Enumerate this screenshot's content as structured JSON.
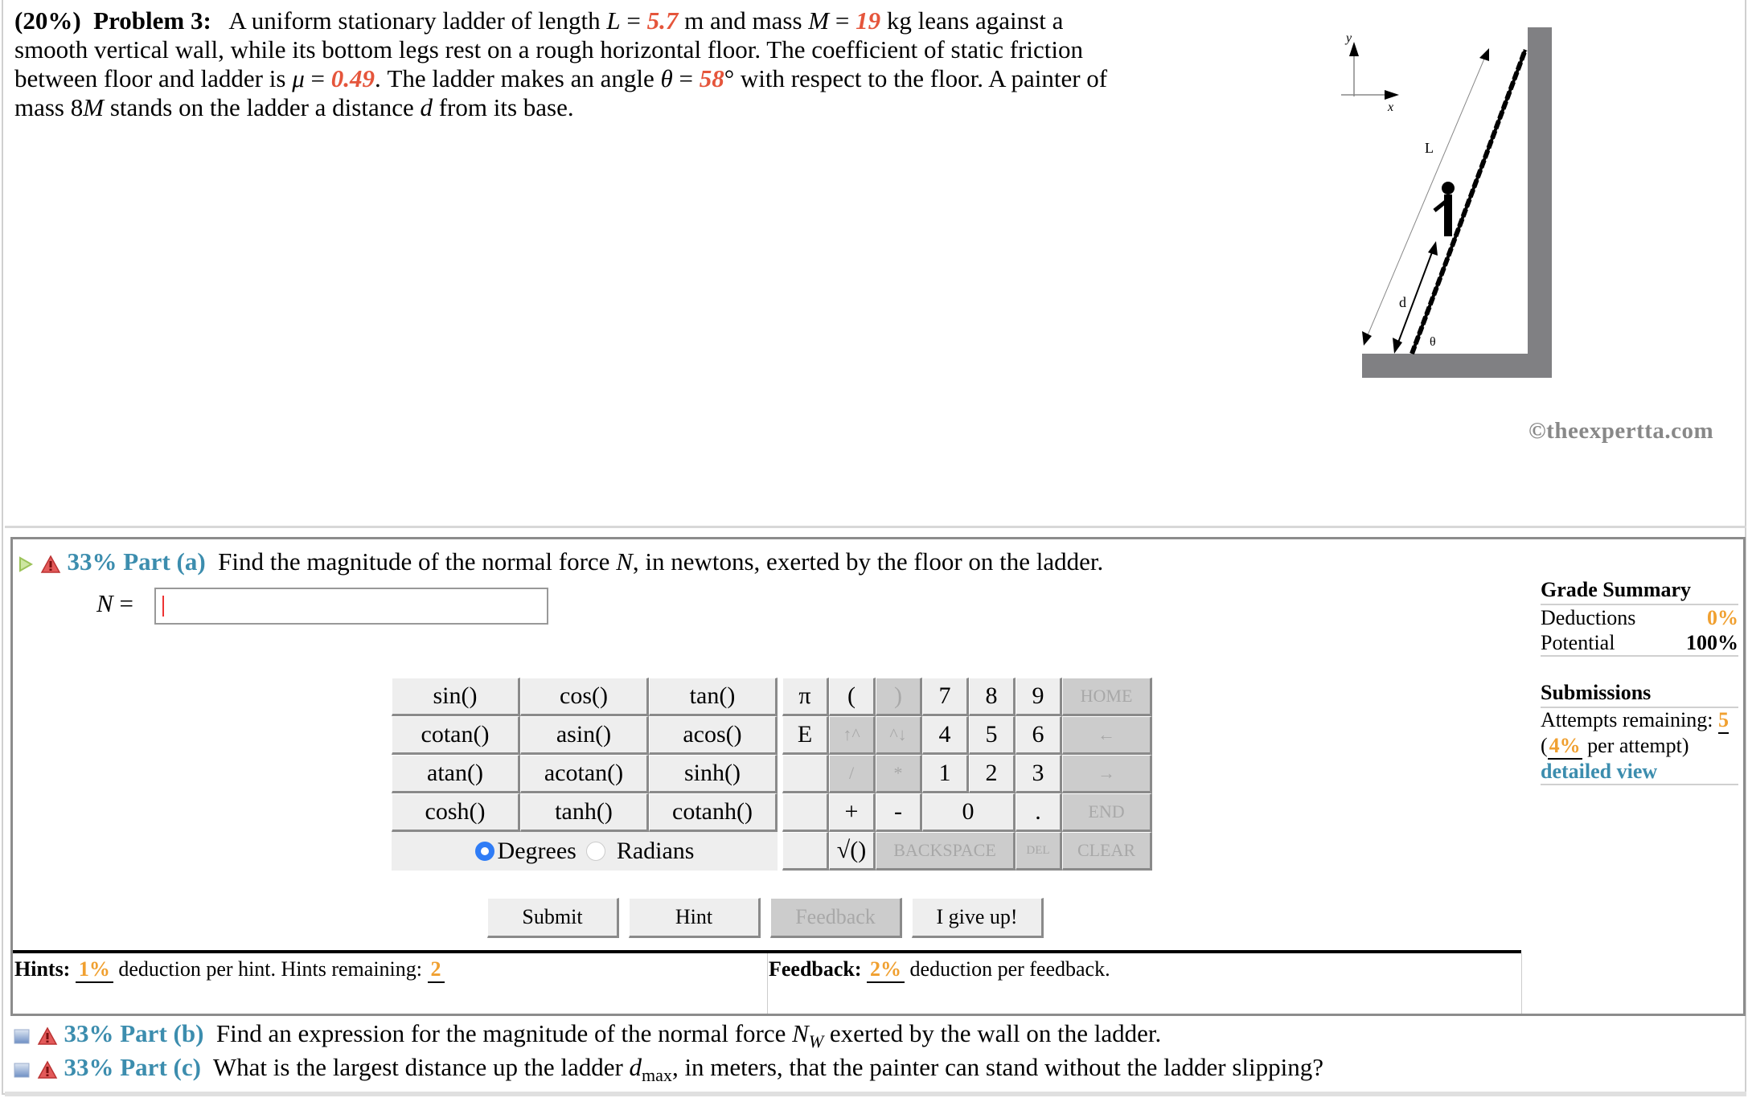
{
  "problem": {
    "weight": "(20%)",
    "title": "Problem 3:",
    "t1": "A uniform stationary ladder of length ",
    "L_sym": "L",
    "eq": " = ",
    "L_val": "5.7",
    "t2": " m and mass ",
    "M_sym": "M",
    "M_val": "19",
    "t3": " kg leans against a smooth vertical wall, while its bottom legs rest on a rough horizontal floor. The coefficient of static friction between floor and ladder is ",
    "mu_sym": "μ",
    "mu_val": "0.49",
    "t4": ". The ladder makes an angle ",
    "theta_sym": "θ",
    "theta_val": "58",
    "t5": "° with respect to the floor. A painter of mass 8",
    "M_sym2": "M",
    "t6": " stands on the ladder a distance ",
    "d_sym": "d",
    "t7": " from its base."
  },
  "diagram": {
    "labels": {
      "y": "y",
      "x": "x",
      "L": "L",
      "d": "d",
      "theta": "θ"
    },
    "copyright": "©theexpertta.com"
  },
  "part_a": {
    "percent": "33%",
    "label": "Part (a)",
    "question_1": "Find the magnitude of the normal force ",
    "question_var": "N",
    "question_2": ", in newtons, exerted by the floor on the ladder.",
    "answer_label": "N",
    "answer_eq": " = ",
    "answer_value": ""
  },
  "keypad": {
    "functions": [
      [
        "sin()",
        "cos()",
        "tan()"
      ],
      [
        "cotan()",
        "asin()",
        "acos()"
      ],
      [
        "atan()",
        "acotan()",
        "sinh()"
      ],
      [
        "cosh()",
        "tanh()",
        "cotanh()"
      ]
    ],
    "angle_mode": {
      "degrees": "Degrees",
      "radians": "Radians",
      "selected": "Degrees"
    },
    "keys": {
      "pi": "π",
      "lparen": "(",
      "rparen": ")",
      "n7": "7",
      "n8": "8",
      "n9": "9",
      "home": "HOME",
      "e": "E",
      "up": "↑^",
      "down": "^↓",
      "n4": "4",
      "n5": "5",
      "n6": "6",
      "left": "←",
      "div": "/",
      "mul": "*",
      "n1": "1",
      "n2": "2",
      "n3": "3",
      "right": "→",
      "plus": "+",
      "minus": "-",
      "n0": "0",
      "dot": ".",
      "end": "END",
      "sqrt": "√()",
      "backspace": "BACKSPACE",
      "del": "DEL",
      "clear": "CLEAR"
    }
  },
  "actions": {
    "submit": "Submit",
    "hint": "Hint",
    "feedback": "Feedback",
    "giveup": "I give up!"
  },
  "hints": {
    "label": "Hints:",
    "pct": "1%",
    "text": " deduction per hint. Hints remaining: ",
    "remaining": "2"
  },
  "feedback": {
    "label": "Feedback:",
    "pct": "2%",
    "text": " deduction per feedback."
  },
  "grade_summary": {
    "title": "Grade Summary",
    "deductions_label": "Deductions",
    "deductions": "0%",
    "potential_label": "Potential",
    "potential": "100%",
    "submissions_title": "Submissions",
    "attempts_label": "Attempts remaining: ",
    "attempts": "5",
    "per_attempt_pct": "4%",
    "per_attempt_text": " per attempt)",
    "detailed_view": "detailed view"
  },
  "part_b": {
    "percent": "33%",
    "label": "Part (b)",
    "q1": "Find an expression for the magnitude of the normal force ",
    "var": "N",
    "sub": "W",
    "q2": " exerted by the wall on the ladder."
  },
  "part_c": {
    "percent": "33%",
    "label": "Part (c)",
    "q1": "What is the largest distance up the ladder ",
    "var": "d",
    "sub": "max",
    "q2": ", in meters, that the painter can stand without the ladder slipping?"
  }
}
